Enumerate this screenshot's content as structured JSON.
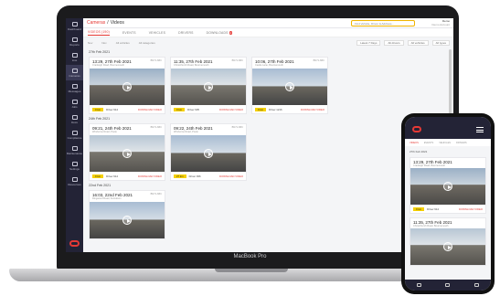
{
  "device_label": "MacBook Pro",
  "header": {
    "crumb_parent": "Cameras",
    "crumb_sep": "/",
    "crumb_current": "Videos",
    "search_placeholder": "Find Vehicle, Driver & Address...",
    "user_name": "Demo",
    "user_company": "Demo Account"
  },
  "sidebar": {
    "items": [
      {
        "label": "Dashboard",
        "active": false
      },
      {
        "label": "Reports",
        "active": false
      },
      {
        "label": "Live",
        "active": false
      },
      {
        "label": "Cameras",
        "active": true
      },
      {
        "label": "Messages",
        "active": false
      },
      {
        "label": "Jobs",
        "active": false
      },
      {
        "label": "Docs",
        "active": false
      },
      {
        "label": "Compliance",
        "active": false
      },
      {
        "label": "Maintenance",
        "active": false
      },
      {
        "label": "Settings",
        "active": false
      },
      {
        "label": "Resources",
        "active": false
      }
    ]
  },
  "tabs": [
    {
      "label": "VIDEOS",
      "count": "(190)",
      "on": true
    },
    {
      "label": "EVENTS",
      "on": false
    },
    {
      "label": "VEHICLES",
      "on": false
    },
    {
      "label": "DRIVERS",
      "on": false
    },
    {
      "label": "DOWNLOADS",
      "badge": "2",
      "on": false
    }
  ],
  "filters": {
    "left": [
      "Nov",
      "Nov",
      "All vehicles",
      "All categories"
    ],
    "right": [
      "Latest 7 Days",
      "All drivers",
      "All vehicles",
      "All types"
    ]
  },
  "groups": [
    {
      "date": "27th Feb 2021",
      "cards": [
        {
          "time": "13:29, 27th Feb 2021",
          "sub": "Cranleigh Road, Bournemouth",
          "id": "BN71 ABC",
          "speed": "0 km",
          "driver": "Driver 914",
          "dl": "DOWNLOAD VIDEO"
        },
        {
          "time": "11:35, 27th Feb 2021",
          "sub": "Christchurch Road, Bournemouth",
          "id": "BN71 ABC",
          "speed": "0 km",
          "driver": "Driver 935",
          "dl": "DOWNLOAD VIDEO"
        },
        {
          "time": "10:06, 27th Feb 2021",
          "sub": "Castle Lane, Bournemouth",
          "id": "BN71 ABC",
          "speed": "0 km",
          "driver": "Driver 1216",
          "dl": "DOWNLOAD VIDEO"
        }
      ]
    },
    {
      "date": "24th Feb 2021",
      "cards": [
        {
          "time": "09:21, 24th Feb 2021",
          "sub": "Wimborne Road, Poole",
          "id": "BN71 ABC",
          "speed": "0 km",
          "driver": "Driver 914",
          "dl": "DOWNLOAD VIDEO"
        },
        {
          "time": "09:22, 24th Feb 2021",
          "sub": "Wimborne Road, Poole",
          "id": "BN71 ABC",
          "speed": "27 km",
          "driver": "Driver 936",
          "dl": "DOWNLOAD VIDEO"
        }
      ]
    },
    {
      "date": "22nd Feb 2021",
      "cards": [
        {
          "time": "16:03, 22nd Feb 2021",
          "sub": "Ringwood Road, Ferndown",
          "id": "BN71 ABC",
          "speed": "",
          "driver": "",
          "dl": ""
        }
      ]
    }
  ],
  "phone": {
    "tabs": [
      "VIDEOS",
      "EVENTS",
      "VEHICLES",
      "DRIVERS"
    ],
    "date": "27th Feb 2021",
    "cards": [
      {
        "time": "13:29, 27th Feb 2021",
        "sub": "Cranleigh Road, Bournemouth",
        "speed": "0 km",
        "driver": "Driver 914",
        "dl": "DOWNLOAD VIDEO"
      },
      {
        "time": "11:35, 27th Feb 2021",
        "sub": "Christchurch Road, Bournemouth",
        "speed": "",
        "driver": "",
        "dl": ""
      }
    ]
  },
  "colors": {
    "accent": "#e53935",
    "speed": "#f5d000",
    "sidebar": "#232336"
  }
}
